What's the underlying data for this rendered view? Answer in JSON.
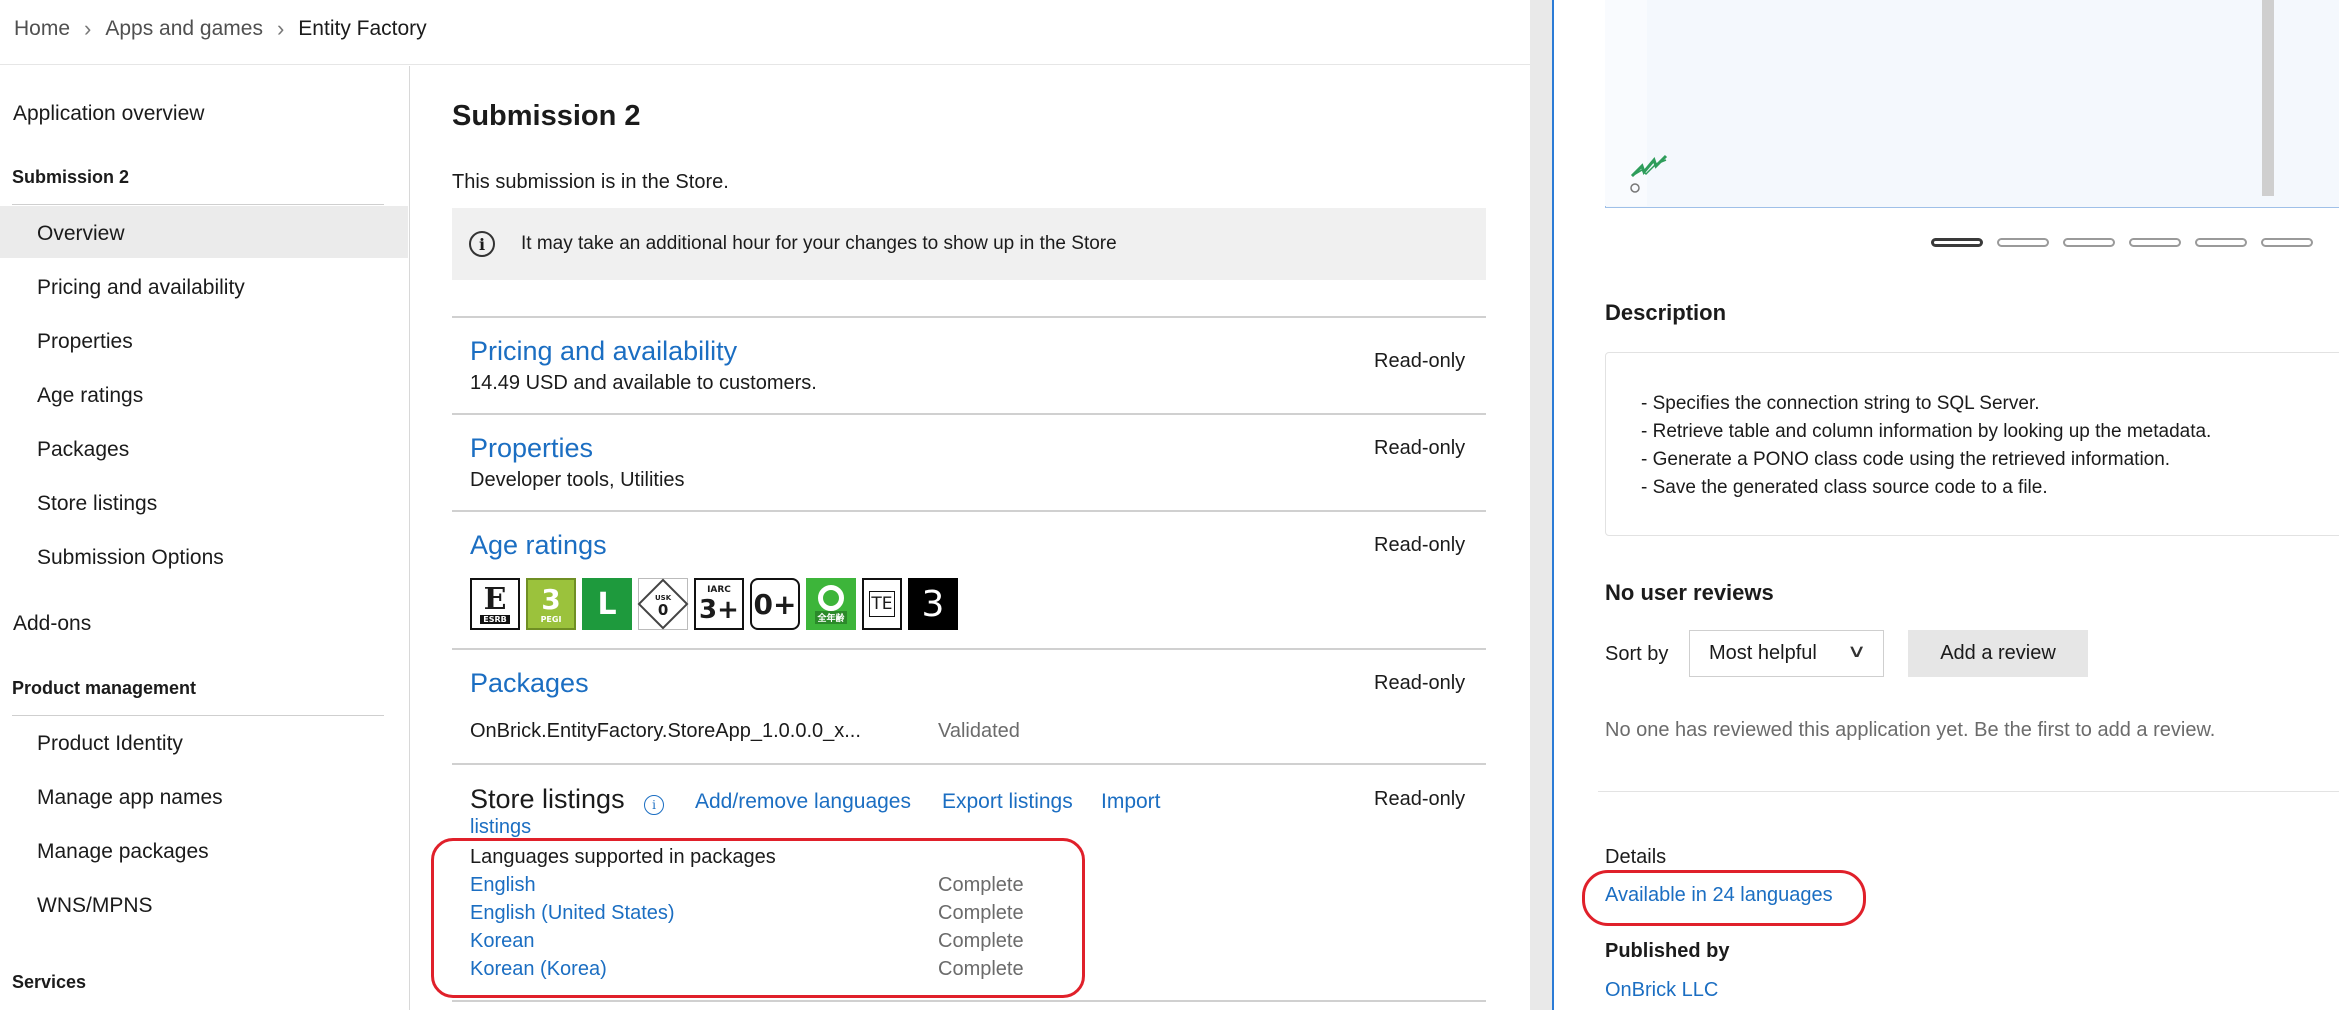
{
  "breadcrumb": {
    "home": "Home",
    "apps": "Apps and games",
    "current": "Entity Factory"
  },
  "nav": {
    "app_overview": "Application overview",
    "submission_section": "Submission 2",
    "submission_items": [
      "Overview",
      "Pricing and availability",
      "Properties",
      "Age ratings",
      "Packages",
      "Store listings",
      "Submission Options"
    ],
    "addons": "Add-ons",
    "product_section": "Product management",
    "product_items": [
      "Product Identity",
      "Manage app names",
      "Manage packages",
      "WNS/MPNS"
    ],
    "services_section": "Services",
    "selected": "Overview"
  },
  "main": {
    "title": "Submission 2",
    "status_text": "This submission is in the Store.",
    "info_text": "It may take an additional hour for your changes to show up in the Store",
    "readonly_label": "Read-only",
    "pricing": {
      "title": "Pricing and availability",
      "desc": "14.49 USD and available to customers."
    },
    "properties": {
      "title": "Properties",
      "desc": "Developer tools, Utilities"
    },
    "age_ratings": {
      "title": "Age ratings",
      "badges": [
        {
          "name": "esrb-e",
          "main": "E",
          "sub": "ESRB"
        },
        {
          "name": "pegi-3",
          "main": "3",
          "sub": "PEGI"
        },
        {
          "name": "classind-l",
          "main": "L",
          "sub": ""
        },
        {
          "name": "usk-0",
          "main": "0",
          "sub": "USK"
        },
        {
          "name": "iarc-3",
          "main": "3+",
          "sub": "IARC"
        },
        {
          "name": "generic-0",
          "main": "0+",
          "sub": ""
        },
        {
          "name": "grac-all",
          "main": "",
          "sub": "全年齢"
        },
        {
          "name": "csrr-te",
          "main": "TE",
          "sub": ""
        },
        {
          "name": "rating-3",
          "main": "3",
          "sub": ""
        }
      ]
    },
    "packages": {
      "title": "Packages",
      "name": "OnBrick.EntityFactory.StoreApp_1.0.0.0_x...",
      "status": "Validated"
    },
    "store_listings": {
      "title": "Store listings",
      "add_remove": "Add/remove languages",
      "export": "Export listings",
      "import_1": "Import",
      "import_2": "listings",
      "languages_heading": "Languages supported in packages",
      "languages": [
        {
          "name": "English",
          "status": "Complete"
        },
        {
          "name": "English (United States)",
          "status": "Complete"
        },
        {
          "name": "Korean",
          "status": "Complete"
        },
        {
          "name": "Korean (Korea)",
          "status": "Complete"
        }
      ]
    }
  },
  "preview": {
    "description_heading": "Description",
    "description_lines": [
      "- Specifies the connection string to SQL Server.",
      "- Retrieve table and column information by looking up the metadata.",
      "- Generate a PONO class code using the retrieved information.",
      "- Save the generated class source code to a file."
    ],
    "reviews_heading": "No user reviews",
    "sort_label": "Sort by",
    "sort_value": "Most helpful",
    "add_review": "Add a review",
    "no_reviews_text": "No one has reviewed this application yet. Be the first to add a review.",
    "details_label": "Details",
    "languages_link": "Available in 24 languages",
    "published_by_label": "Published by",
    "publisher": "OnBrick LLC"
  },
  "colors": {
    "link": "#1b6ec2",
    "highlight": "#e0202a",
    "selected_bg": "#ebebeb"
  }
}
